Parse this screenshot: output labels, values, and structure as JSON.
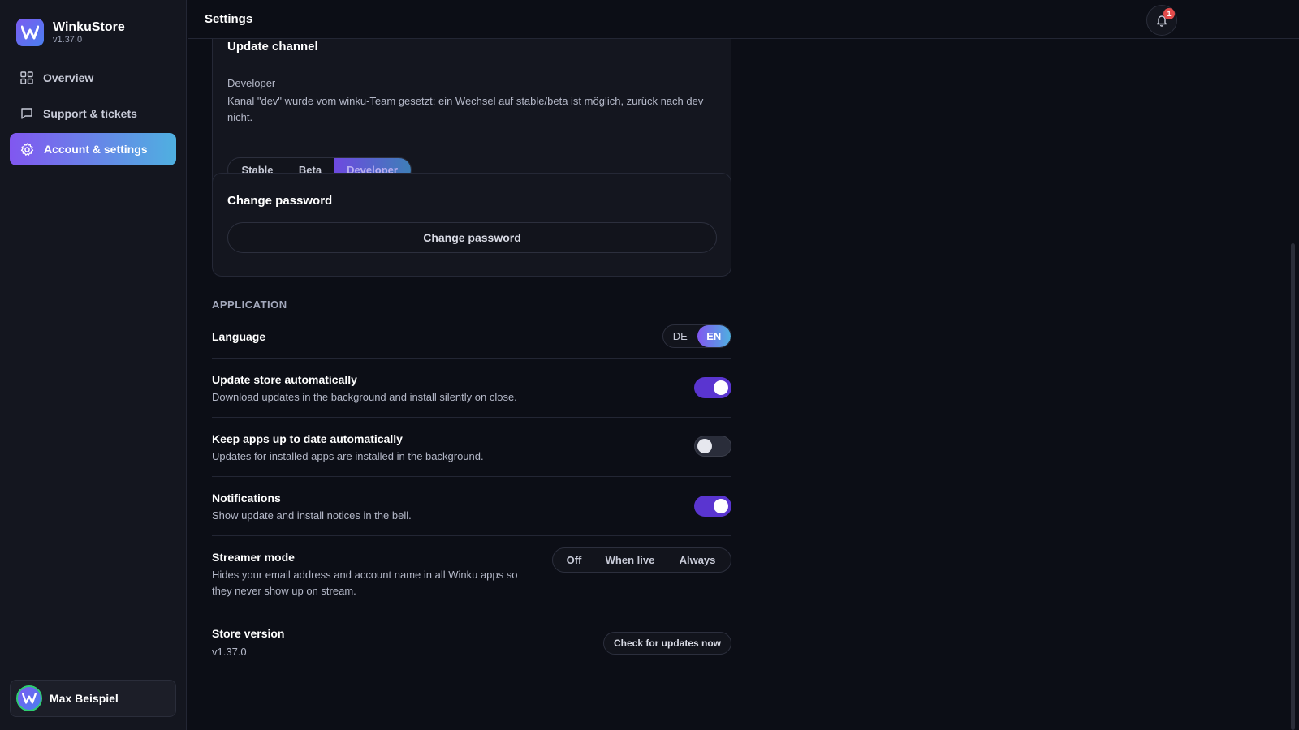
{
  "app": {
    "name": "WinkuStore",
    "version": "v1.37.0",
    "accent": "#8157f0"
  },
  "sidebar": {
    "items": [
      {
        "label": "Overview",
        "icon": "grid-icon"
      },
      {
        "label": "Support & tickets",
        "icon": "chat-icon"
      },
      {
        "label": "Account & settings",
        "icon": "gear-icon",
        "active": true
      }
    ],
    "user": {
      "name": "Max Beispiel"
    }
  },
  "header": {
    "title": "Settings",
    "notification_count": "1"
  },
  "update_channel": {
    "title": "Update channel",
    "current": "Developer",
    "description": "Kanal \"dev\" wurde vom winku-Team gesetzt; ein Wechsel auf stable/beta ist möglich, zurück nach dev nicht.",
    "options": [
      "Stable",
      "Beta",
      "Developer"
    ],
    "selected": "Developer"
  },
  "password": {
    "title": "Change password",
    "button_label": "Change password"
  },
  "application": {
    "section_label": "APPLICATION",
    "language": {
      "title": "Language",
      "options": [
        "DE",
        "EN"
      ],
      "selected": "EN"
    },
    "update_store": {
      "title": "Update store automatically",
      "description": "Download updates in the background and install silently on close.",
      "enabled": true
    },
    "keep_apps": {
      "title": "Keep apps up to date automatically",
      "description": "Updates for installed apps are installed in the background.",
      "enabled": false
    },
    "notifications": {
      "title": "Notifications",
      "description": "Show update and install notices in the bell.",
      "enabled": true
    },
    "streamer_mode": {
      "title": "Streamer mode",
      "description": "Hides your email address and account name in all Winku apps so they never show up on stream.",
      "options": [
        "Off",
        "When live",
        "Always"
      ]
    },
    "store_version": {
      "title": "Store version",
      "value": "v1.37.0",
      "button_label": "Check for updates now"
    }
  }
}
